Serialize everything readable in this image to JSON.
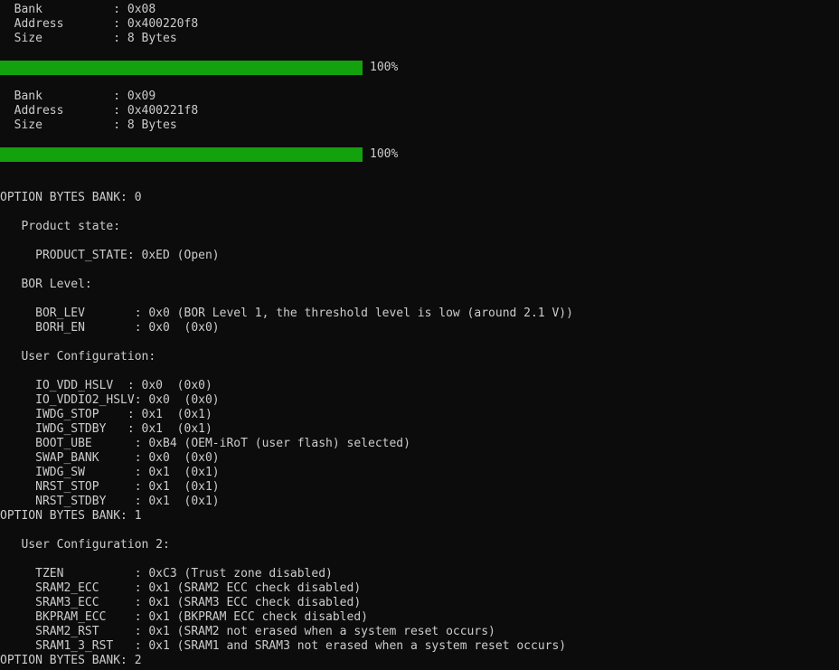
{
  "theme": {
    "background": "#0c0c0c",
    "text": "#cccccc",
    "progress_color": "#13a10e"
  },
  "terminal": {
    "bank_08": {
      "bank": "  Bank          : 0x08",
      "address": "  Address       : 0x400220f8",
      "size": "  Size          : 8 Bytes",
      "progress_percent": 100,
      "progress_label": "100%"
    },
    "bank_09": {
      "bank": "  Bank          : 0x09",
      "address": "  Address       : 0x400221f8",
      "size": "  Size          : 8 Bytes",
      "progress_percent": 100,
      "progress_label": "100%"
    },
    "ob_bank0_header": "OPTION BYTES BANK: 0",
    "product_state_heading": "   Product state:",
    "product_state": "     PRODUCT_STATE: 0xED (Open)",
    "bor_heading": "   BOR Level:",
    "bor_lev": "     BOR_LEV       : 0x0 (BOR Level 1, the threshold level is low (around 2.1 V))",
    "borh_en": "     BORH_EN       : 0x0  (0x0)",
    "user_config_heading": "   User Configuration:",
    "user_config": [
      "     IO_VDD_HSLV  : 0x0  (0x0)",
      "     IO_VDDIO2_HSLV: 0x0  (0x0)",
      "     IWDG_STOP    : 0x1  (0x1)",
      "     IWDG_STDBY   : 0x1  (0x1)",
      "     BOOT_UBE      : 0xB4 (OEM-iRoT (user flash) selected)",
      "     SWAP_BANK     : 0x0  (0x0)",
      "     IWDG_SW       : 0x1  (0x1)",
      "     NRST_STOP     : 0x1  (0x1)",
      "     NRST_STDBY    : 0x1  (0x1)"
    ],
    "ob_bank1_header": "OPTION BYTES BANK: 1",
    "user_config2_heading": "   User Configuration 2:",
    "user_config2": [
      "     TZEN          : 0xC3 (Trust zone disabled)",
      "     SRAM2_ECC     : 0x1 (SRAM2 ECC check disabled)",
      "     SRAM3_ECC     : 0x1 (SRAM3 ECC check disabled)",
      "     BKPRAM_ECC    : 0x1 (BKPRAM ECC check disabled)",
      "     SRAM2_RST     : 0x1 (SRAM2 not erased when a system reset occurs)",
      "     SRAM1_3_RST   : 0x1 (SRAM1 and SRAM3 not erased when a system reset occurs)"
    ],
    "ob_bank2_header": "OPTION BYTES BANK: 2"
  }
}
